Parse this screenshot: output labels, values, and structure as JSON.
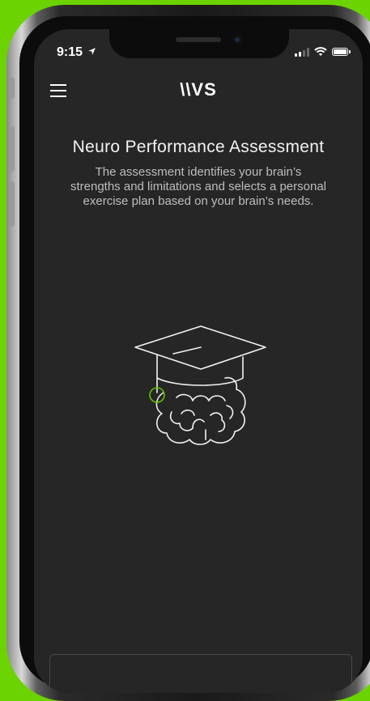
{
  "status_bar": {
    "time": "9:15",
    "location_icon": "location-arrow-icon",
    "signal_icon": "cellular-signal-icon",
    "wifi_icon": "wifi-icon",
    "battery_icon": "battery-icon"
  },
  "header": {
    "menu_icon": "hamburger-menu-icon",
    "logo_text": "\\\\VS"
  },
  "main": {
    "title": "Neuro Performance Assessment",
    "description": "The assessment identifies your brain’s strengths and limitations and selects a personal exercise plan based on your brain’s needs.",
    "illustration_icon": "graduation-cap-brain-icon"
  },
  "colors": {
    "background": "#6bd400",
    "screen": "#262626",
    "accent": "#5fbf00",
    "text": "#f2f2f2"
  }
}
